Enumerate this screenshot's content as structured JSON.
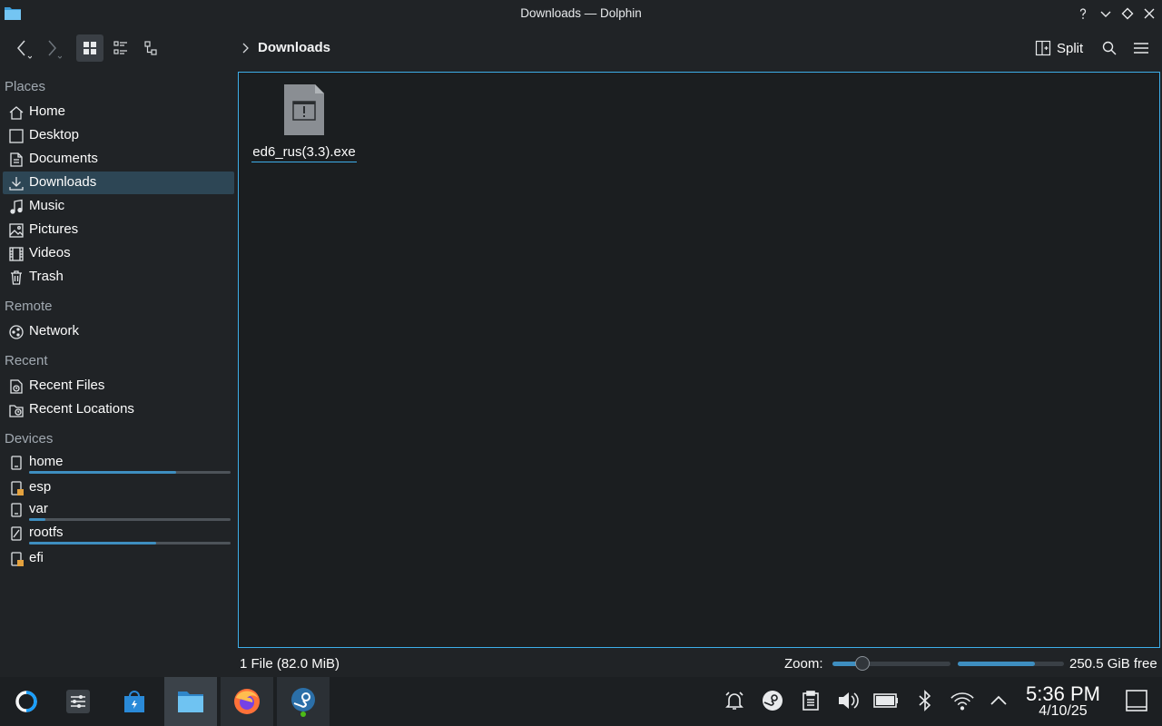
{
  "window": {
    "title": "Downloads — Dolphin",
    "icons": [
      "folder-icon",
      "help-icon",
      "minimize-icon",
      "maximize-icon",
      "close-icon"
    ]
  },
  "toolbar": {
    "breadcrumb": "Downloads",
    "split_label": "Split",
    "icons": [
      "back-icon",
      "forward-icon",
      "icons-view-icon",
      "compact-view-icon",
      "details-view-icon",
      "split-icon",
      "search-icon",
      "menu-icon"
    ]
  },
  "sidebar": {
    "places_header": "Places",
    "places": [
      {
        "label": "Home",
        "icon": "home-icon"
      },
      {
        "label": "Desktop",
        "icon": "desktop-icon"
      },
      {
        "label": "Documents",
        "icon": "documents-icon"
      },
      {
        "label": "Downloads",
        "icon": "downloads-icon",
        "selected": true
      },
      {
        "label": "Music",
        "icon": "music-icon"
      },
      {
        "label": "Pictures",
        "icon": "pictures-icon"
      },
      {
        "label": "Videos",
        "icon": "videos-icon"
      },
      {
        "label": "Trash",
        "icon": "trash-icon"
      }
    ],
    "remote_header": "Remote",
    "remote": [
      {
        "label": "Network",
        "icon": "network-icon"
      }
    ],
    "recent_header": "Recent",
    "recent": [
      {
        "label": "Recent Files",
        "icon": "recent-files-icon"
      },
      {
        "label": "Recent Locations",
        "icon": "recent-locations-icon"
      }
    ],
    "devices_header": "Devices",
    "devices": [
      {
        "label": "home",
        "icon": "drive-icon",
        "usage": 0.73
      },
      {
        "label": "esp",
        "icon": "drive-locked-icon"
      },
      {
        "label": "var",
        "icon": "drive-icon",
        "usage": 0.08
      },
      {
        "label": "rootfs",
        "icon": "drive-readonly-icon",
        "usage": 0.63
      },
      {
        "label": "efi",
        "icon": "drive-locked-icon"
      }
    ]
  },
  "files": [
    {
      "name": "ed6_rus(3.3).exe",
      "icon": "executable-file-icon"
    }
  ],
  "statusbar": {
    "summary": "1 File (82.0 MiB)",
    "zoom_label": "Zoom:",
    "zoom_level": 0.25,
    "free_space": "250.5 GiB free",
    "used_fraction": 0.73
  },
  "taskbar": {
    "apps": [
      "steamos-menu-icon",
      "system-settings-icon",
      "discover-store-icon",
      "dolphin-icon",
      "firefox-icon",
      "steam-icon"
    ],
    "tray": [
      "notifications-icon",
      "steam-tray-icon",
      "clipboard-icon",
      "volume-icon",
      "battery-icon",
      "bluetooth-icon",
      "wifi-icon",
      "tray-expand-icon"
    ],
    "time": "5:36 PM",
    "date": "4/10/25"
  },
  "colors": {
    "accent": "#3daee9",
    "selection": "#2d4655",
    "background": "#202326",
    "view_background": "#1b1e20"
  }
}
